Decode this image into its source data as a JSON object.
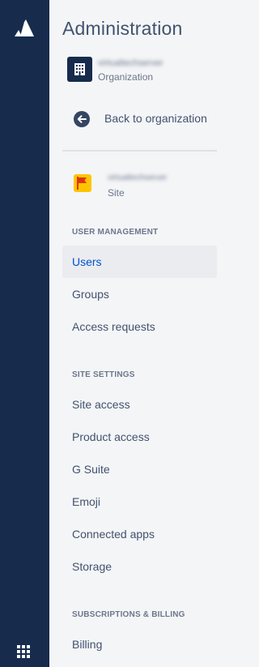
{
  "header": {
    "title": "Administration"
  },
  "organization": {
    "name": "virtualtechserver",
    "type_label": "Organization",
    "icon": "building-icon"
  },
  "back": {
    "label": "Back to organization",
    "icon": "arrow-left-icon"
  },
  "site": {
    "name": "virtualtechserver",
    "type_label": "Site",
    "icon": "flag-icon"
  },
  "sections": [
    {
      "heading": "USER MANAGEMENT",
      "items": [
        {
          "label": "Users",
          "active": true
        },
        {
          "label": "Groups",
          "active": false
        },
        {
          "label": "Access requests",
          "active": false
        }
      ]
    },
    {
      "heading": "SITE SETTINGS",
      "items": [
        {
          "label": "Site access",
          "active": false
        },
        {
          "label": "Product access",
          "active": false
        },
        {
          "label": "G Suite",
          "active": false
        },
        {
          "label": "Emoji",
          "active": false
        },
        {
          "label": "Connected apps",
          "active": false
        },
        {
          "label": "Storage",
          "active": false
        }
      ]
    },
    {
      "heading": "SUBSCRIPTIONS & BILLING",
      "items": [
        {
          "label": "Billing",
          "active": false
        }
      ]
    }
  ],
  "colors": {
    "global_nav": "#172b4d",
    "panel": "#f4f5f7",
    "text": "#42526e",
    "active_text": "#0052cc",
    "active_bg": "#ebecf0",
    "site_icon": "#ffc400"
  }
}
